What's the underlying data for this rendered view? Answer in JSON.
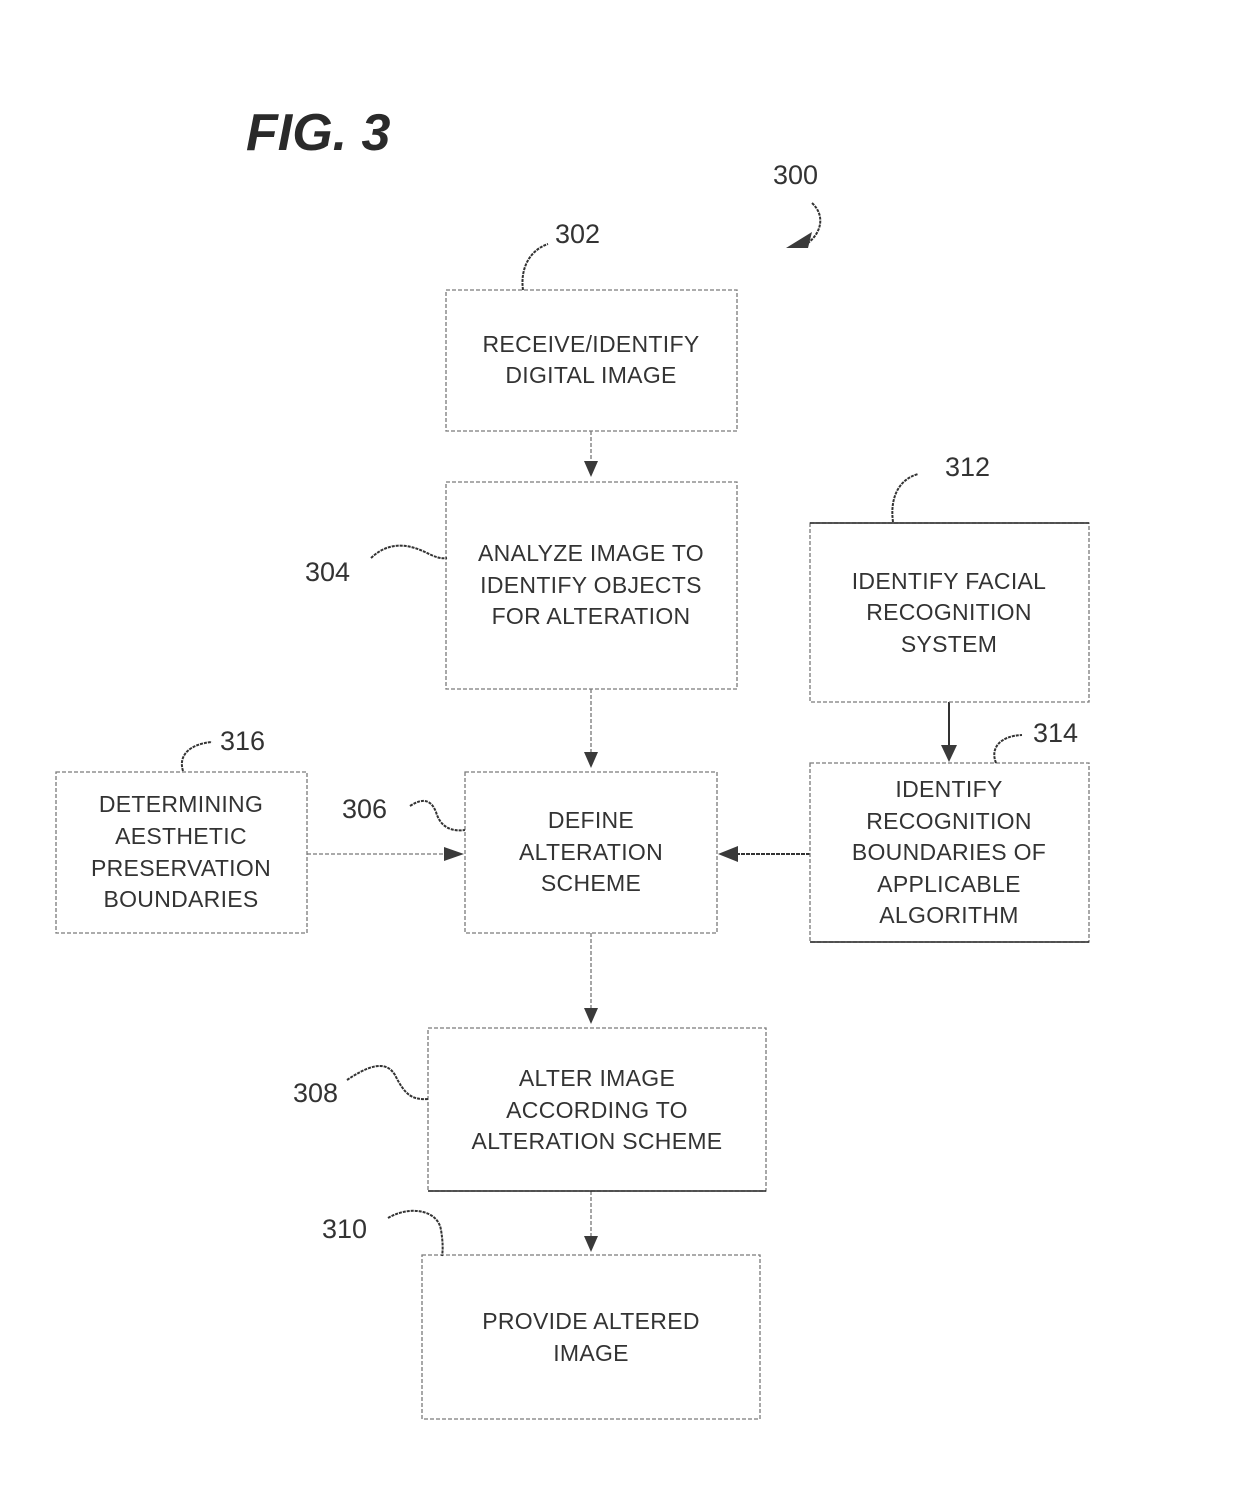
{
  "figure": {
    "title": "FIG. 3",
    "reference": "300"
  },
  "nodes": [
    {
      "id": "302",
      "ref": "302",
      "lines": [
        "RECEIVE/IDENTIFY",
        "DIGITAL IMAGE"
      ]
    },
    {
      "id": "304",
      "ref": "304",
      "lines": [
        "ANALYZE IMAGE TO",
        "IDENTIFY OBJECTS",
        "FOR ALTERATION"
      ]
    },
    {
      "id": "306",
      "ref": "306",
      "lines": [
        "DEFINE",
        "ALTERATION",
        "SCHEME"
      ]
    },
    {
      "id": "308",
      "ref": "308",
      "lines": [
        "ALTER IMAGE",
        "ACCORDING TO",
        "ALTERATION SCHEME"
      ]
    },
    {
      "id": "310",
      "ref": "310",
      "lines": [
        "PROVIDE ALTERED",
        "IMAGE"
      ]
    },
    {
      "id": "312",
      "ref": "312",
      "lines": [
        "IDENTIFY FACIAL",
        "RECOGNITION",
        "SYSTEM"
      ]
    },
    {
      "id": "314",
      "ref": "314",
      "lines": [
        "IDENTIFY",
        "RECOGNITION",
        "BOUNDARIES OF",
        "APPLICABLE",
        "ALGORITHM"
      ]
    },
    {
      "id": "316",
      "ref": "316",
      "lines": [
        "DETERMINING",
        "AESTHETIC",
        "PRESERVATION",
        "BOUNDARIES"
      ]
    }
  ],
  "edges": [
    {
      "from": "302",
      "to": "304"
    },
    {
      "from": "304",
      "to": "306"
    },
    {
      "from": "306",
      "to": "308"
    },
    {
      "from": "308",
      "to": "310"
    },
    {
      "from": "312",
      "to": "314"
    },
    {
      "from": "314",
      "to": "306"
    },
    {
      "from": "316",
      "to": "306"
    }
  ]
}
